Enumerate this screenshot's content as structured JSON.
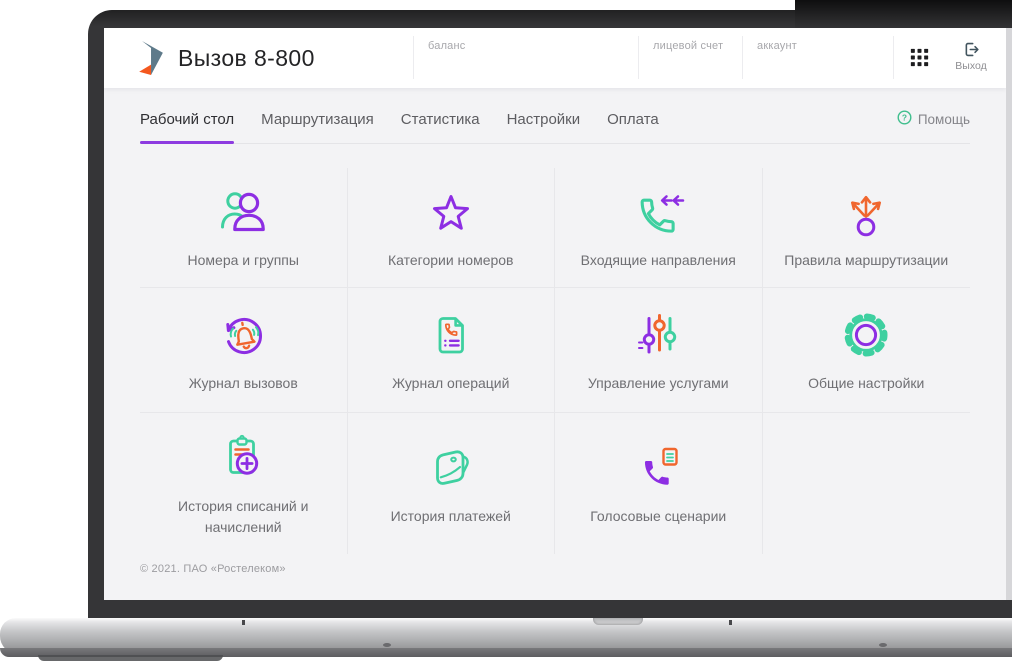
{
  "header": {
    "app_title": "Вызов 8-800",
    "account_fields": [
      {
        "id": "balance",
        "label": "баланс"
      },
      {
        "id": "personal-account",
        "label": "лицевой счет"
      },
      {
        "id": "account",
        "label": "аккаунт"
      }
    ],
    "logout_label": "Выход"
  },
  "nav": {
    "tabs": [
      {
        "id": "desktop",
        "label": "Рабочий стол",
        "active": true
      },
      {
        "id": "routing",
        "label": "Маршрутизация",
        "active": false
      },
      {
        "id": "statistics",
        "label": "Статистика",
        "active": false
      },
      {
        "id": "settings",
        "label": "Настройки",
        "active": false
      },
      {
        "id": "payment",
        "label": "Оплата",
        "active": false
      }
    ],
    "help_label": "Помощь"
  },
  "tiles": [
    {
      "id": "numbers-groups",
      "label": "Номера и группы",
      "icon": "users-icon"
    },
    {
      "id": "number-categories",
      "label": "Категории номеров",
      "icon": "star-icon"
    },
    {
      "id": "incoming-directions",
      "label": "Входящие направления",
      "icon": "incoming-call-icon"
    },
    {
      "id": "routing-rules",
      "label": "Правила маршрутизации",
      "icon": "routing-rules-icon"
    },
    {
      "id": "call-journal",
      "label": "Журнал вызовов",
      "icon": "call-journal-icon"
    },
    {
      "id": "operations-journal",
      "label": "Журнал операций",
      "icon": "operations-journal-icon"
    },
    {
      "id": "service-management",
      "label": "Управление услугами",
      "icon": "service-sliders-icon"
    },
    {
      "id": "general-settings",
      "label": "Общие настройки",
      "icon": "gear-icon"
    },
    {
      "id": "charges-history",
      "label": "История списаний и начислений",
      "icon": "clipboard-plus-icon"
    },
    {
      "id": "payments-history",
      "label": "История платежей",
      "icon": "wallet-icon"
    },
    {
      "id": "voice-scenarios",
      "label": "Голосовые сценарии",
      "icon": "voice-scenario-icon"
    }
  ],
  "footer": {
    "copyright": "© 2021. ПАО «Ростелеком»"
  },
  "colors": {
    "teal": "#3ed0a0",
    "purple": "#8d2ee3",
    "orange": "#f0662e",
    "tab_underline": "#8d3be0",
    "help_green": "#3fbe8d",
    "logo_slate": "#5e7a8a",
    "logo_orange": "#f4581f",
    "background": "#f3f3f5"
  }
}
